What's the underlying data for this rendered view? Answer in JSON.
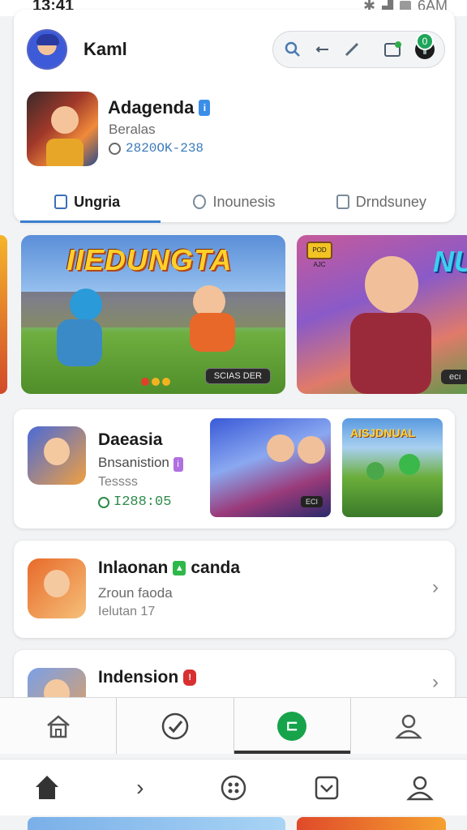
{
  "status_bar": {
    "time": "13:41",
    "right_text": "6AM"
  },
  "header": {
    "username": "Kaml"
  },
  "featured_app": {
    "title": "Adagenda",
    "subtitle": "Beralas",
    "meta": "2820OK-238"
  },
  "tabs": [
    {
      "label": "Ungria",
      "icon": "home-icon",
      "active": true
    },
    {
      "label": "Inounesis",
      "icon": "chat-icon",
      "active": false
    },
    {
      "label": "Drndsuney",
      "icon": "document-icon",
      "active": false
    }
  ],
  "banners": {
    "main_title": "IIEDUNGTA",
    "main_chip": "SCIAS DER",
    "second_badge": "POD AJC",
    "second_title": "NU",
    "second_chip": "ecı"
  },
  "cards": [
    {
      "title": "Daeasia",
      "line1": "Bnsanistion",
      "line2": "Tessss",
      "meta": "I288:05",
      "thumb1_chip": "ECI",
      "thumb2_title": "AISJDNUAL"
    },
    {
      "title": "Inlaonan",
      "title_suffix": "canda",
      "line1": "Zroun faoda",
      "line2": "Ielutan 17"
    },
    {
      "title": "Indension"
    }
  ],
  "nav_primary": [
    "home-icon",
    "check-circle-icon",
    "green-badge-icon",
    "profile-icon"
  ],
  "nav_secondary": [
    "home-filled-icon",
    "chevron-right-icon",
    "grid-icon",
    "checkbox-icon",
    "profile-icon"
  ],
  "notification_count": "0"
}
